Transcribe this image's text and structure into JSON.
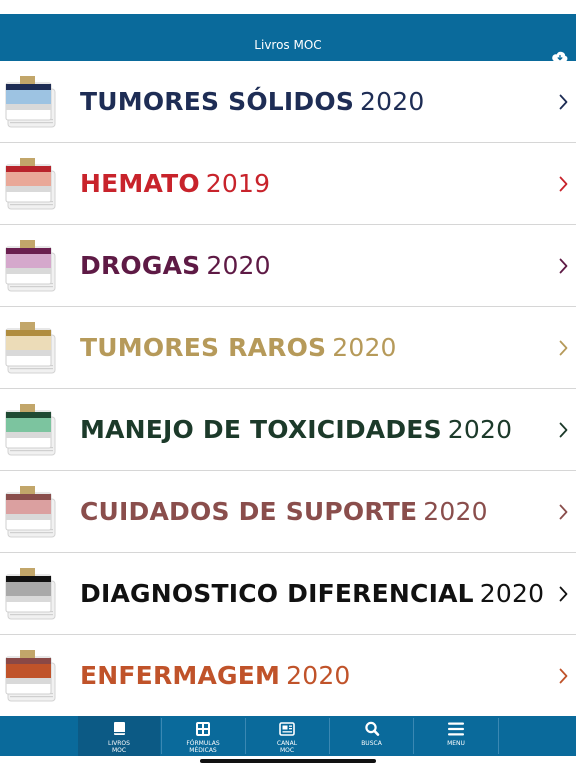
{
  "header": {
    "title": "Livros MOC",
    "cloud_icon": "cloud-download-icon"
  },
  "books": [
    {
      "title": "TUMORES SÓLIDOS",
      "year": "2020",
      "color": "#1e2d55",
      "band": "#9dc3e2",
      "ribbon": "#1e2d55",
      "chevron": "#1e2d55"
    },
    {
      "title": "HEMATO",
      "year": "2019",
      "color": "#c8232b",
      "band": "#e9a898",
      "ribbon": "#b8232b",
      "chevron": "#c8232b"
    },
    {
      "title": "DROGAS",
      "year": "2020",
      "color": "#5e1a45",
      "band": "#d5a8cc",
      "ribbon": "#6a1f4f",
      "chevron": "#5e1a45"
    },
    {
      "title": "TUMORES RAROS",
      "year": "2020",
      "color": "#b69a5a",
      "band": "#ecdcb8",
      "ribbon": "#b08d3f",
      "chevron": "#b69a5a"
    },
    {
      "title": "MANEJO DE TOXICIDADES",
      "year": "2020",
      "color": "#1c3a2a",
      "band": "#7cc49f",
      "ribbon": "#1f4a33",
      "chevron": "#1c3a2a"
    },
    {
      "title": "CUIDADOS DE SUPORTE",
      "year": "2020",
      "color": "#8a4e4c",
      "band": "#dba0a0",
      "ribbon": "#8a4e4c",
      "chevron": "#8a4e4c"
    },
    {
      "title": "DIAGNOSTICO DIFERENCIAL",
      "year": "2020",
      "color": "#111111",
      "band": "#a9a9a9",
      "ribbon": "#111111",
      "chevron": "#111111"
    },
    {
      "title": "ENFERMAGEM",
      "year": "2020",
      "color": "#c0532a",
      "band": "#c0532a",
      "ribbon": "#8a4846",
      "chevron": "#c0532a"
    }
  ],
  "tabs": [
    {
      "line1": "LIVROS",
      "line2": "MOC",
      "icon": "book-icon",
      "active": true
    },
    {
      "line1": "FÓRMULAS",
      "line2": "MÉDICAS",
      "icon": "calculator-icon",
      "active": false
    },
    {
      "line1": "CANAL",
      "line2": "MOC",
      "icon": "news-icon",
      "active": false
    },
    {
      "line1": "BUSCA",
      "line2": "",
      "icon": "search-icon",
      "active": false
    },
    {
      "line1": "MENU",
      "line2": "",
      "icon": "menu-icon",
      "active": false
    }
  ],
  "colors": {
    "header": "#0a6a9b",
    "tab_active": "#0c5a85"
  }
}
